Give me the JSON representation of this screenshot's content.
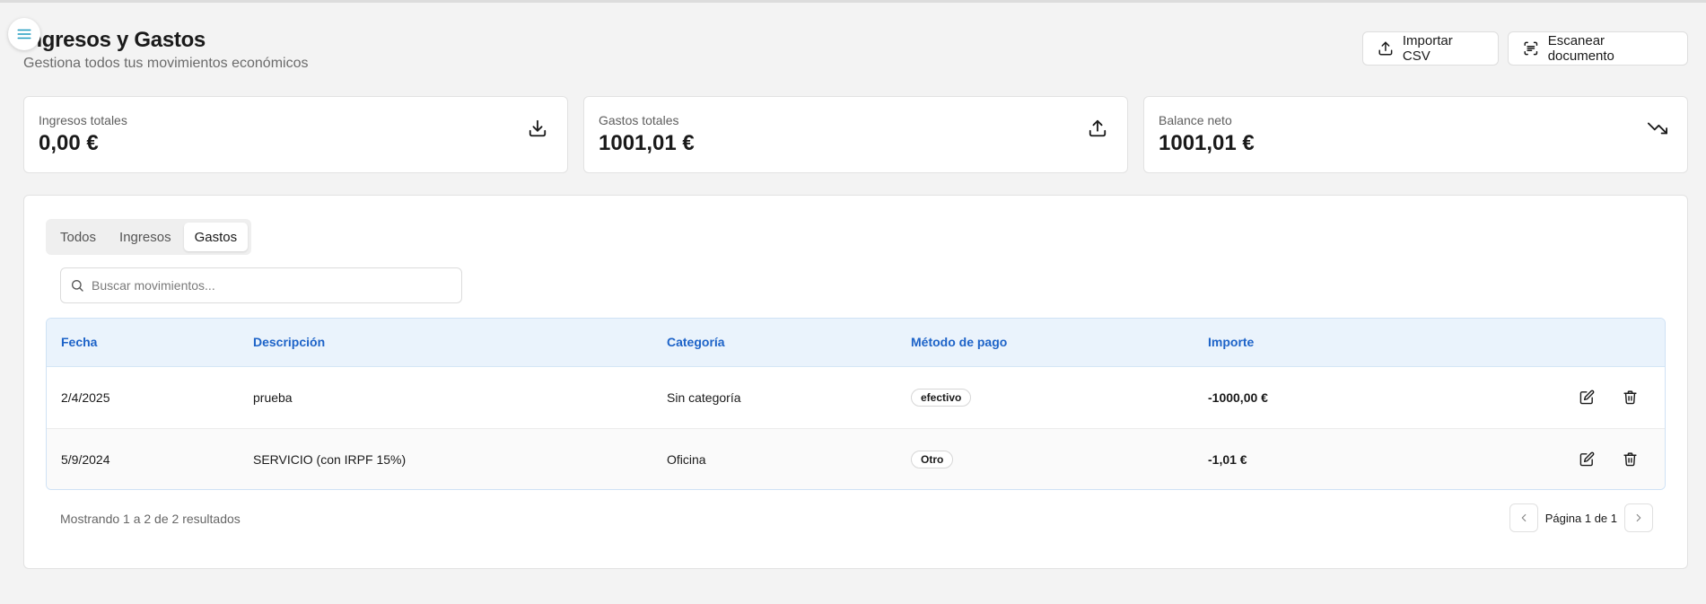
{
  "header": {
    "title": "Ingresos y Gastos",
    "subtitle": "Gestiona todos tus movimientos económicos"
  },
  "actions": {
    "import_label": "Importar CSV",
    "scan_label": "Escanear documento"
  },
  "stats": [
    {
      "label": "Ingresos totales",
      "value": "0,00 €",
      "icon": "download-icon"
    },
    {
      "label": "Gastos totales",
      "value": "1001,01 €",
      "icon": "upload-icon"
    },
    {
      "label": "Balance neto",
      "value": "1001,01 €",
      "icon": "trending-down-icon"
    }
  ],
  "tabs": [
    {
      "label": "Todos",
      "active": false
    },
    {
      "label": "Ingresos",
      "active": false
    },
    {
      "label": "Gastos",
      "active": true
    }
  ],
  "search": {
    "placeholder": "Buscar movimientos..."
  },
  "table": {
    "columns": [
      "Fecha",
      "Descripción",
      "Categoría",
      "Método de pago",
      "Importe"
    ],
    "rows": [
      {
        "fecha": "2/4/2025",
        "descripcion": "prueba",
        "categoria": "Sin categoría",
        "metodo": "efectivo",
        "importe": "-1000,00 €"
      },
      {
        "fecha": "5/9/2024",
        "descripcion": "SERVICIO (con IRPF 15%)",
        "categoria": "Oficina",
        "metodo": "Otro",
        "importe": "-1,01 €"
      }
    ]
  },
  "footer": {
    "results": "Mostrando 1 a 2 de 2 resultados",
    "page": "Página 1 de 1"
  },
  "colors": {
    "accent": "#1d63c8",
    "menu_icon": "#1f9bbf"
  }
}
